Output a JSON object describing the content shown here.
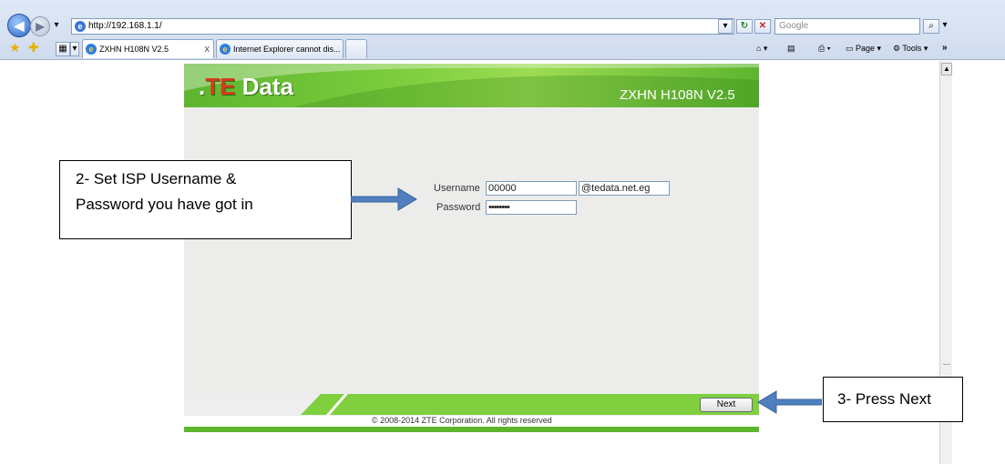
{
  "browser": {
    "address_url": "http://192.168.1.1/",
    "search_placeholder": "Google",
    "tabs": [
      {
        "label": "ZXHN H108N V2.5",
        "active": true
      },
      {
        "label": "Internet Explorer cannot dis...",
        "active": false
      }
    ],
    "tools": {
      "page_label": "Page",
      "tools_label": "Tools"
    }
  },
  "router": {
    "logo_prefix": ".",
    "logo_hot": "TE",
    "logo_rest": " Data",
    "model": "ZXHN H108N V2.5",
    "form": {
      "username_label": "Username",
      "username_value": "00000",
      "domain_value": "@tedata.net.eg",
      "password_label": "Password",
      "password_value": "••••••••"
    },
    "next_label": "Next",
    "copyright": "© 2008-2014 ZTE Corporation. All rights reserved"
  },
  "callouts": {
    "step2_line1": "2- Set ISP Username &",
    "step2_line2": "Password you have got in",
    "step3": "3- Press Next"
  },
  "colors": {
    "brand_green": "#5db52e",
    "callout_arrow": "#4f7fbf"
  }
}
